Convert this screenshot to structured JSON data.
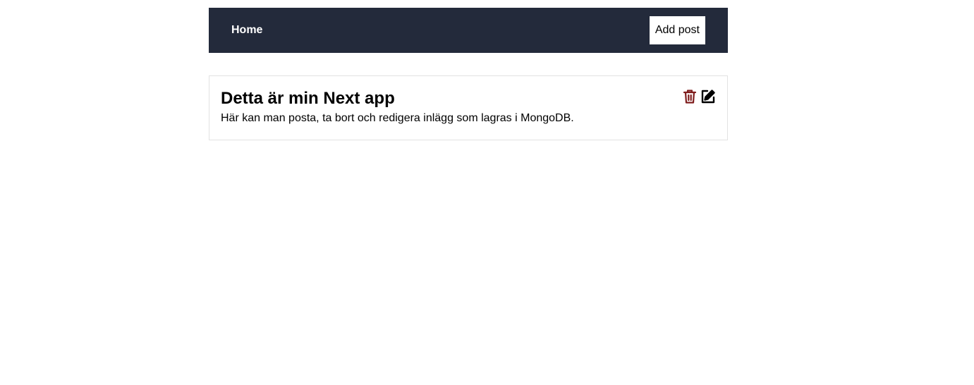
{
  "nav": {
    "home_label": "Home",
    "add_post_label": "Add post"
  },
  "posts": [
    {
      "title": "Detta är min Next app",
      "description": "Här kan man posta, ta bort och redigera inlägg som lagras i MongoDB."
    }
  ],
  "icons": {
    "delete": "trash-icon",
    "edit": "edit-icon"
  },
  "colors": {
    "navbar_bg": "#232a3b",
    "delete_icon": "#7f1d1d",
    "edit_icon": "#000000"
  }
}
